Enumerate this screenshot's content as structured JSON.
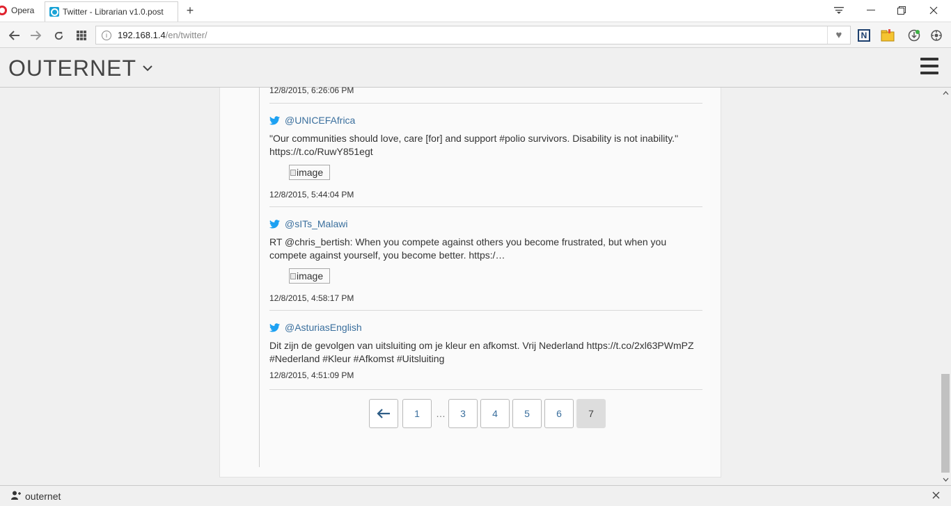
{
  "browser": {
    "menu_label": "Opera",
    "tab_title": "Twitter - Librarian v1.0.post",
    "new_tab": "+",
    "url_host": "192.168.1.4",
    "url_path": "/en/twitter/"
  },
  "site": {
    "brand": "OUTERNET"
  },
  "feed": {
    "first_timestamp": "12/8/2015, 6:26:06 PM",
    "tweets": [
      {
        "handle": "@UNICEFAfrica",
        "text": "\"Our communities should love, care [for] and support #polio survivors. Disability is not inability.\" https://t.co/RuwY851egt",
        "image_alt": "image",
        "timestamp": "12/8/2015, 5:44:04 PM"
      },
      {
        "handle": "@sITs_Malawi",
        "text": "RT @chris_bertish: When you compete against others you become frustrated, but when you compete against yourself, you become better. https:/…",
        "image_alt": "image",
        "timestamp": "12/8/2015, 4:58:17 PM"
      },
      {
        "handle": "@AsturiasEnglish",
        "text": "Dit zijn de gevolgen van uitsluiting om je kleur en afkomst. Vrij Nederland https://t.co/2xl63PWmPZ #Nederland #Kleur #Afkomst #Uitsluiting",
        "timestamp": "12/8/2015, 4:51:09 PM"
      }
    ]
  },
  "pagination": {
    "first": "1",
    "ellipsis": "…",
    "pages": [
      "3",
      "4",
      "5",
      "6"
    ],
    "current": "7"
  },
  "statusbar": {
    "user": "outernet"
  }
}
